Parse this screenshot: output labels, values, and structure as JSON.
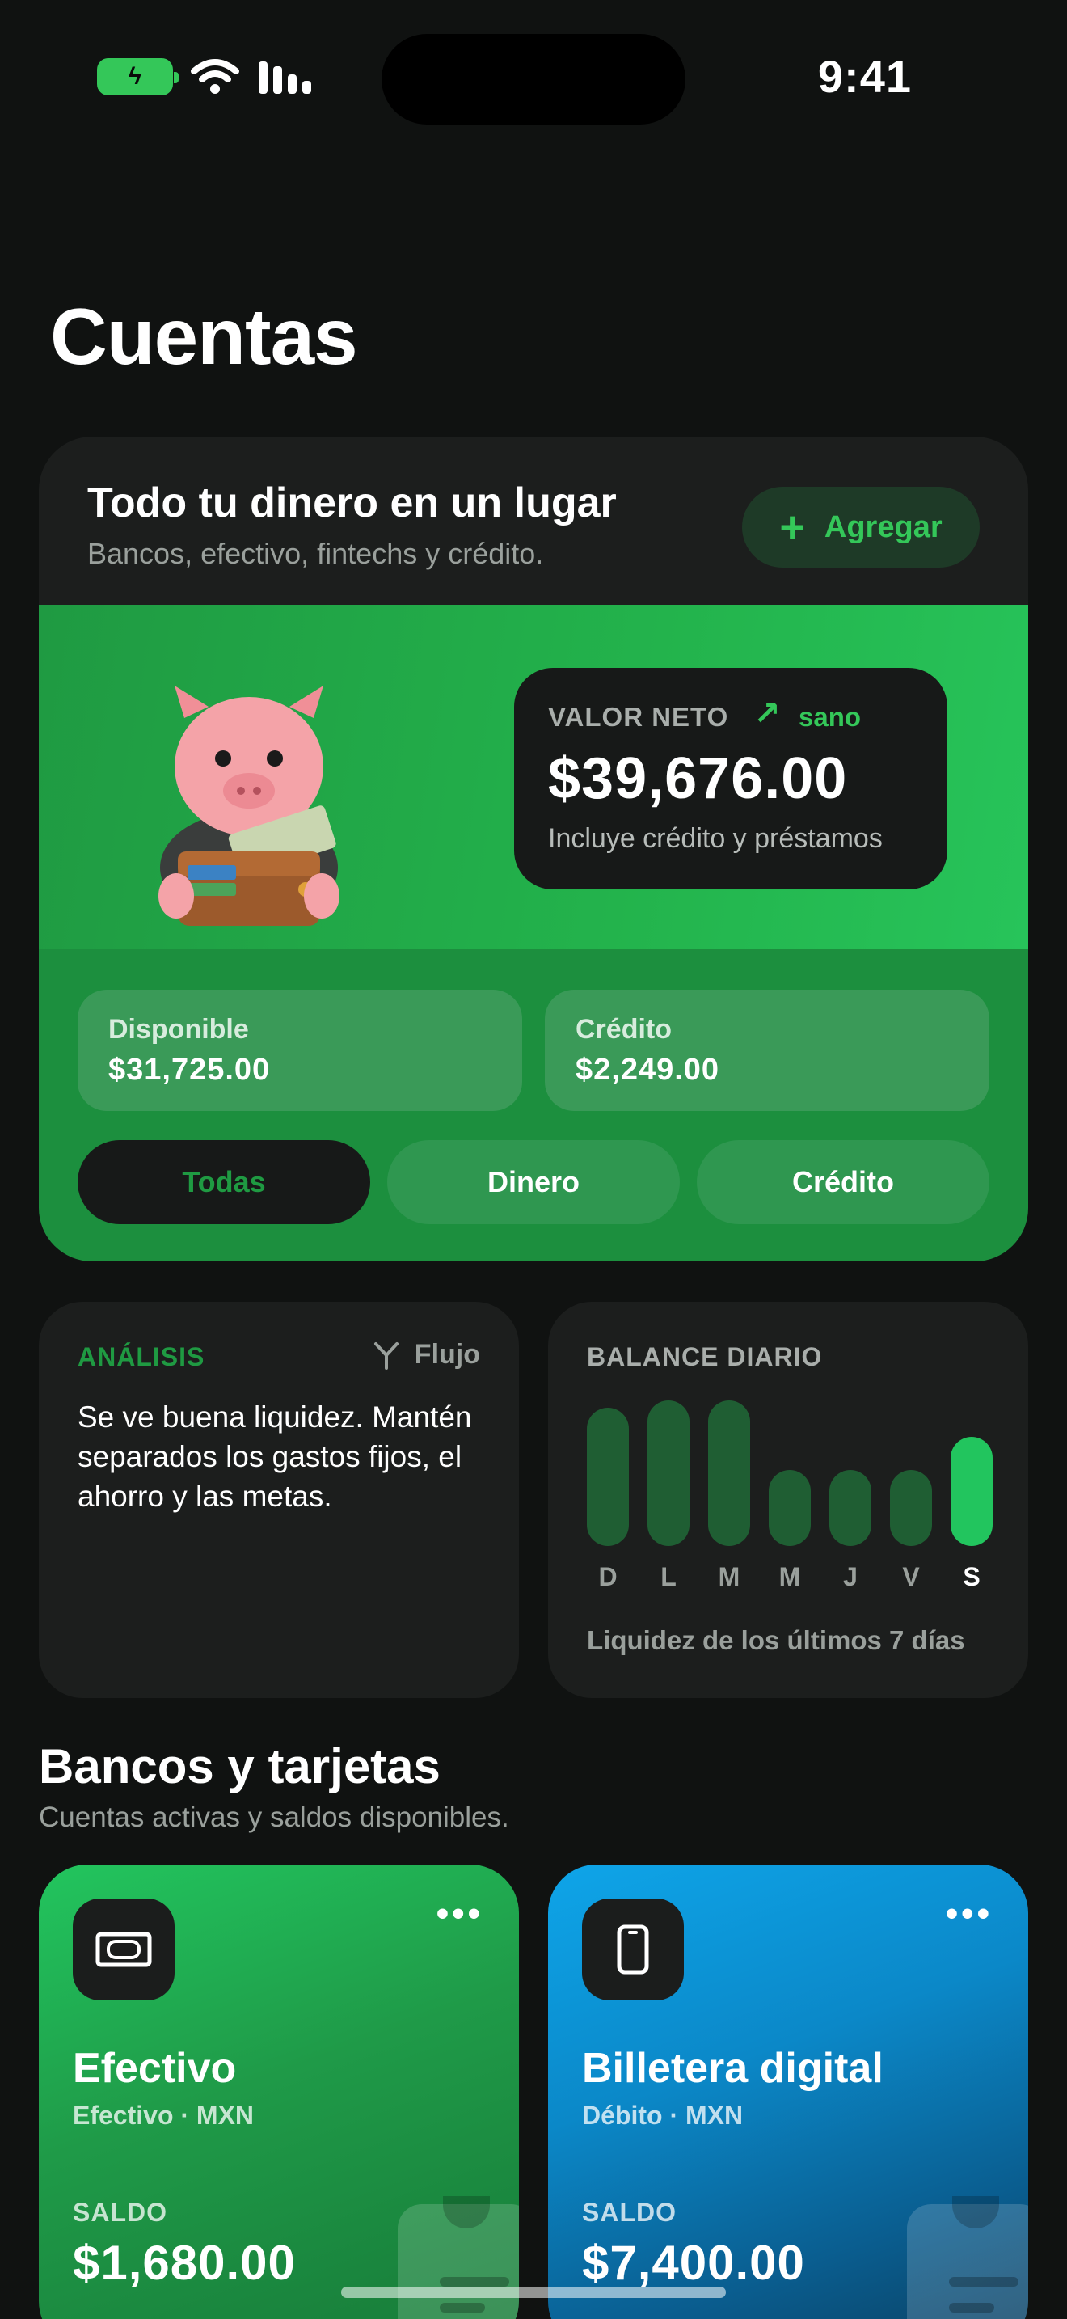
{
  "status_bar": {
    "time": "9:41",
    "battery_icon": "battery-charging-icon",
    "wifi_icon": "wifi-icon",
    "signal_icon": "cellular-signal-icon"
  },
  "page": {
    "title": "Cuentas"
  },
  "summary": {
    "title": "Todo tu dinero en un lugar",
    "subtitle": "Bancos, efectivo, fintechs y crédito.",
    "add_label": "Agregar",
    "net_worth": {
      "label": "VALOR NETO",
      "status": "sano",
      "value": "$39,676.00",
      "note": "Incluye crédito y préstamos"
    },
    "available": {
      "label": "Disponible",
      "value": "$31,725.00"
    },
    "credit": {
      "label": "Crédito",
      "value": "$2,249.00"
    },
    "filters": [
      {
        "label": "Todas",
        "active": true
      },
      {
        "label": "Dinero",
        "active": false
      },
      {
        "label": "Crédito",
        "active": false
      }
    ]
  },
  "analysis": {
    "title": "ANÁLISIS",
    "mode_label": "Flujo",
    "text": "Se ve buena liquidez. Mantén separados los gastos fijos, el ahorro y las metas."
  },
  "daily_balance": {
    "title": "BALANCE DIARIO",
    "days": [
      "D",
      "L",
      "M",
      "M",
      "J",
      "V",
      "S"
    ],
    "levels": [
      0.95,
      1.0,
      1.0,
      0.52,
      0.52,
      0.52,
      0.75
    ],
    "highlight_index": 6,
    "note": "Liquidez de los últimos 7 días"
  },
  "accounts_section": {
    "title": "Bancos y tarjetas",
    "subtitle": "Cuentas activas y saldos disponibles.",
    "accounts": [
      {
        "name": "Efectivo",
        "type": "Efectivo · MXN",
        "saldo_label": "SALDO",
        "saldo": "$1,680.00",
        "icon": "cash-icon",
        "accent": "#22c55e"
      },
      {
        "name": "Billetera digital",
        "type": "Débito · MXN",
        "saldo_label": "SALDO",
        "saldo": "$7,400.00",
        "icon": "phone-icon",
        "accent": "#0ea5e9"
      }
    ]
  }
}
